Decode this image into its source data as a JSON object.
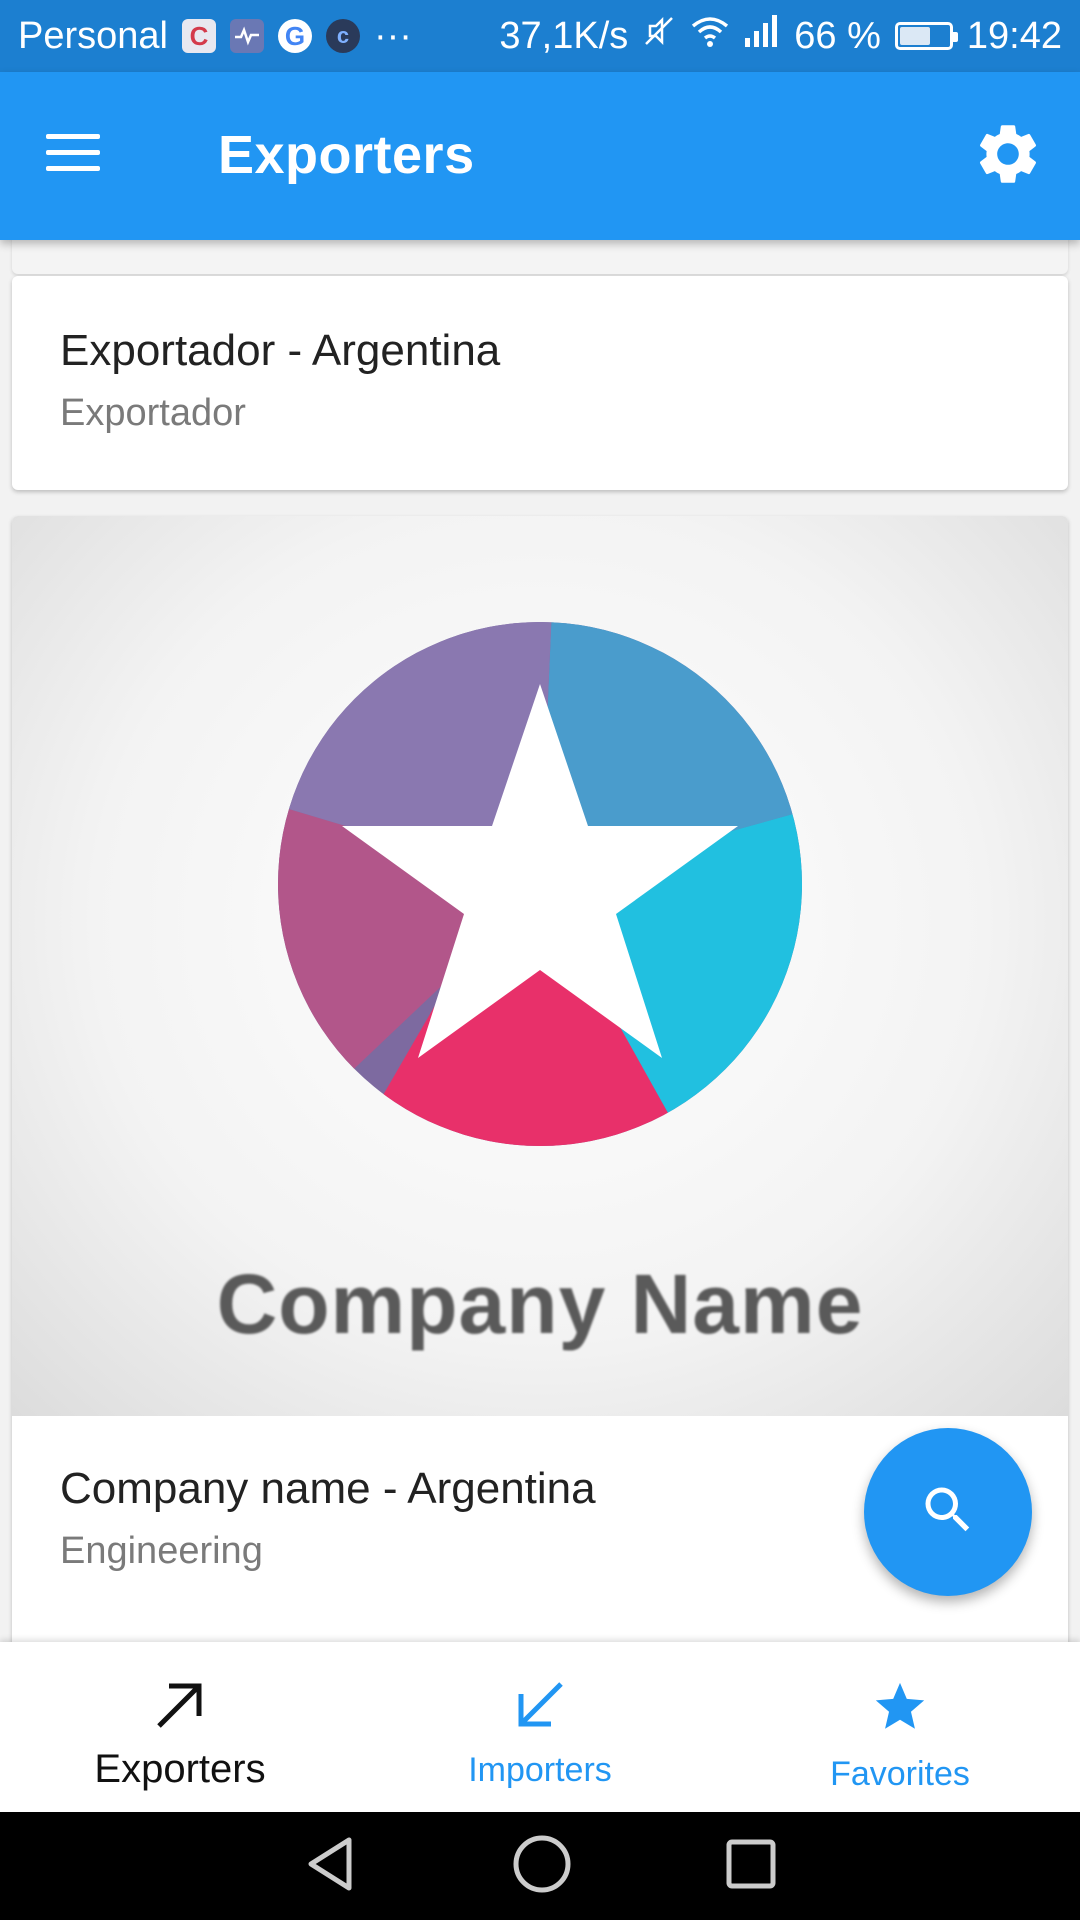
{
  "status_bar": {
    "carrier": "Personal",
    "more": "···",
    "network_speed": "37,1K/s",
    "battery_percent": "66 %",
    "battery_level": 0.66,
    "time": "19:42",
    "notification_icons": [
      "c-app-icon",
      "health-icon",
      "google-icon",
      "c-circle-icon"
    ]
  },
  "app_bar": {
    "title": "Exporters",
    "menu_icon": "hamburger-menu-icon",
    "settings_icon": "gear-icon"
  },
  "cards": [
    {
      "title": "Exportador - Argentina",
      "subtitle": "Exportador"
    },
    {
      "title": "Company name - Argentina",
      "subtitle": "Engineering",
      "image_caption": "Company Name"
    }
  ],
  "fab": {
    "icon": "search-icon"
  },
  "bottom_nav": {
    "items": [
      {
        "label": "Exporters",
        "icon": "arrow-up-right-icon",
        "active": true
      },
      {
        "label": "Importers",
        "icon": "arrow-down-left-icon",
        "active": false
      },
      {
        "label": "Favorites",
        "icon": "star-icon",
        "active": false
      }
    ]
  },
  "colors": {
    "primary": "#2196f3",
    "status_bar": "#1c7fd0",
    "active_nav": "#111111",
    "inactive_nav": "#2196f3"
  }
}
